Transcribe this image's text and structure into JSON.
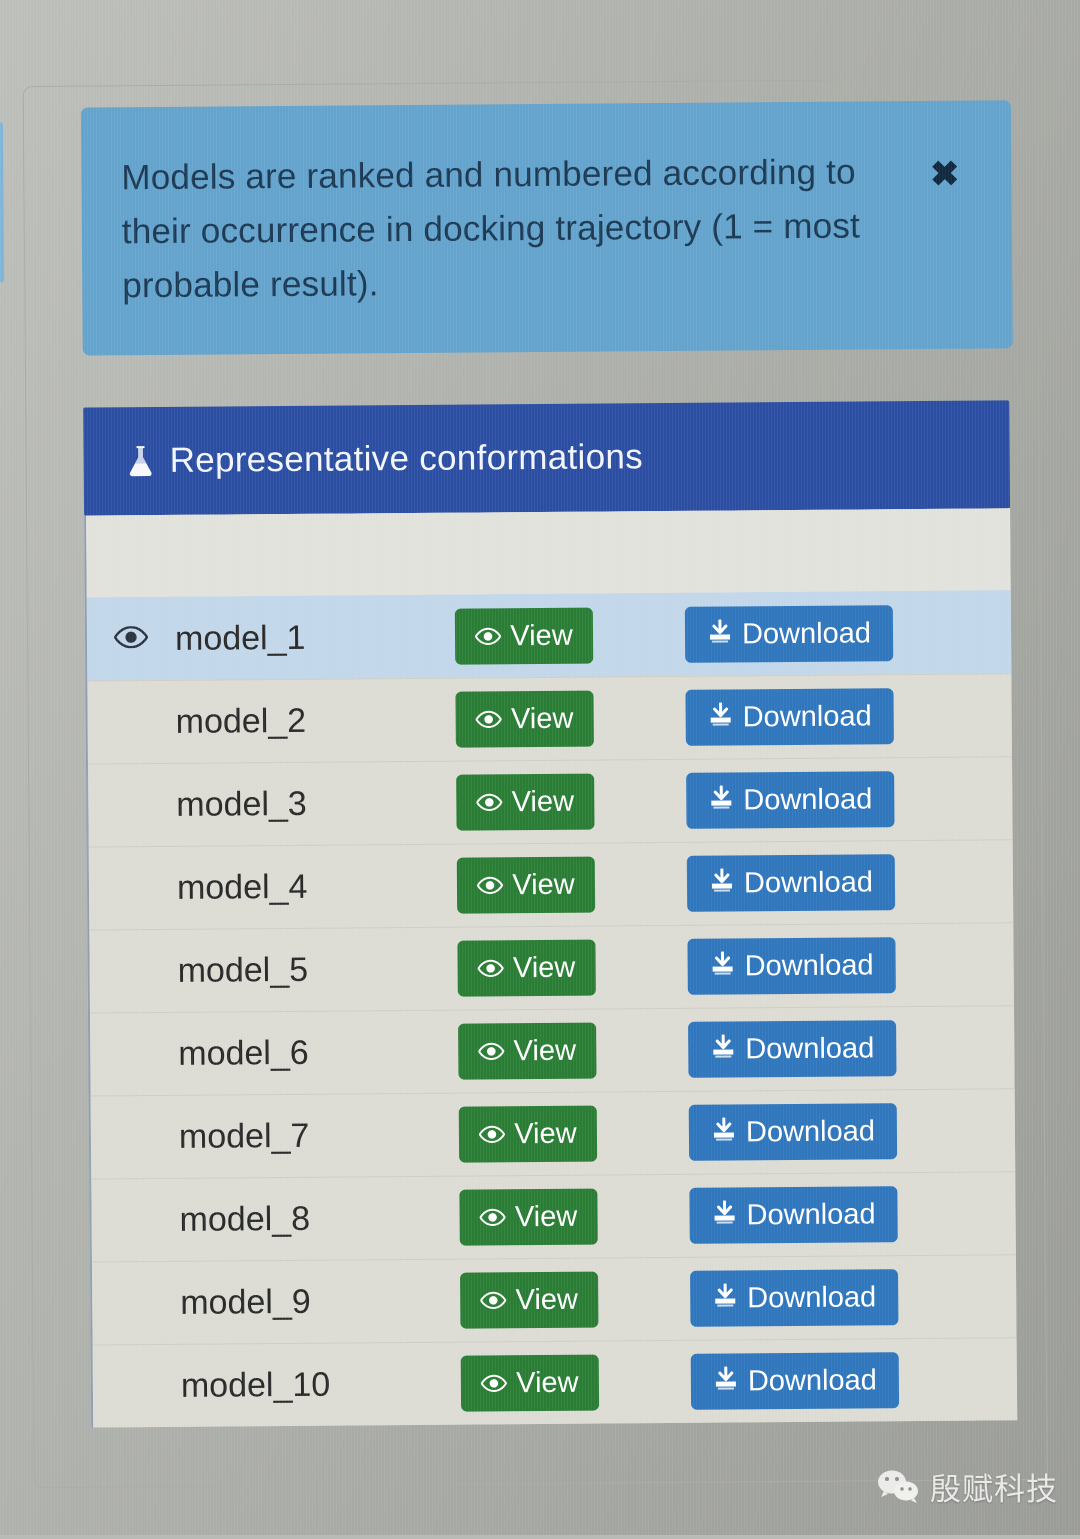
{
  "alert": {
    "message": "Models are ranked and numbered according to\ntheir occurrence in docking trajectory (1 = most\nprobable result).",
    "close_label": "✖",
    "bg_color": "#63a3cc",
    "text_color": "#1d3a55"
  },
  "panel": {
    "title": "Representative conformations",
    "icon": "flask-icon",
    "header_bg": "#2b4ea2"
  },
  "table": {
    "columns": [
      "",
      "",
      "",
      ""
    ],
    "selected_row_index": 0,
    "selected_row_bg": "#c3d7ea",
    "view_button_color": "#2a7d34",
    "download_button_color": "#2f76bd",
    "rows": [
      {
        "name": "model_1",
        "view_label": "View",
        "download_label": "Download",
        "eye_visible": true
      },
      {
        "name": "model_2",
        "view_label": "View",
        "download_label": "Download",
        "eye_visible": false
      },
      {
        "name": "model_3",
        "view_label": "View",
        "download_label": "Download",
        "eye_visible": false
      },
      {
        "name": "model_4",
        "view_label": "View",
        "download_label": "Download",
        "eye_visible": false
      },
      {
        "name": "model_5",
        "view_label": "View",
        "download_label": "Download",
        "eye_visible": false
      },
      {
        "name": "model_6",
        "view_label": "View",
        "download_label": "Download",
        "eye_visible": false
      },
      {
        "name": "model_7",
        "view_label": "View",
        "download_label": "Download",
        "eye_visible": false
      },
      {
        "name": "model_8",
        "view_label": "View",
        "download_label": "Download",
        "eye_visible": false
      },
      {
        "name": "model_9",
        "view_label": "View",
        "download_label": "Download",
        "eye_visible": false
      },
      {
        "name": "model_10",
        "view_label": "View",
        "download_label": "Download",
        "eye_visible": false
      }
    ]
  },
  "watermark": {
    "text": "殷赋科技",
    "icon": "wechat-icon"
  }
}
